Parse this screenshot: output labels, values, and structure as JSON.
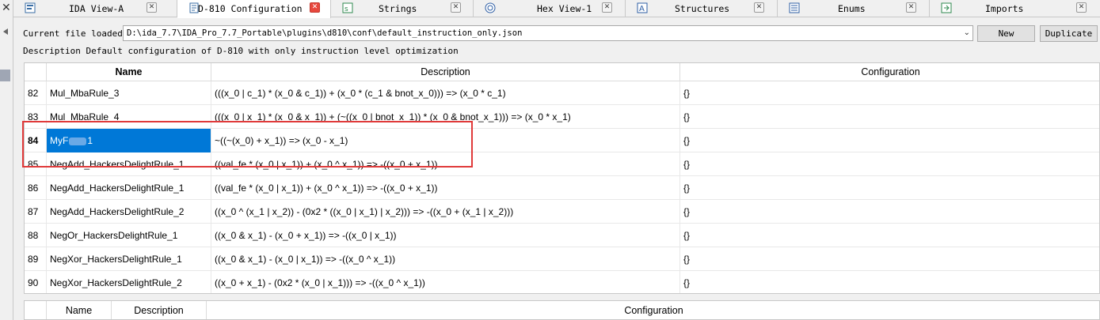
{
  "tabs": [
    {
      "label": "IDA View-A",
      "icon": "ida-view-icon",
      "active": false
    },
    {
      "label": "D-810 Configuration",
      "icon": "config-icon",
      "active": true
    },
    {
      "label": "Strings",
      "icon": "strings-icon",
      "active": false
    },
    {
      "label": "Hex View-1",
      "icon": "hex-view-icon",
      "active": false
    },
    {
      "label": "Structures",
      "icon": "structures-icon",
      "active": false
    },
    {
      "label": "Enums",
      "icon": "enums-icon",
      "active": false
    },
    {
      "label": "Imports",
      "icon": "imports-icon",
      "active": false
    }
  ],
  "file": {
    "label": "Current file loaded:",
    "path": "D:\\ida_7.7\\IDA_Pro_7.7_Portable\\plugins\\d810\\conf\\default_instruction_only.json"
  },
  "buttons": {
    "new": "New",
    "duplicate": "Duplicate"
  },
  "description": {
    "label": "Description",
    "value": "Default configuration of D-810 with only instruction level optimization"
  },
  "table": {
    "headers": {
      "name": "Name",
      "description": "Description",
      "configuration": "Configuration"
    },
    "rows": [
      {
        "num": "82",
        "name": "Mul_MbaRule_3",
        "desc": "(((x_0 | c_1) * (x_0 & c_1)) + (x_0 * (c_1 & bnot_x_0))) => (x_0 * c_1)",
        "conf": "{}"
      },
      {
        "num": "83",
        "name": "Mul_MbaRule_4",
        "desc": "(((x_0 | x_1) * (x_0 & x_1)) + (~((x_0 | bnot_x_1)) * (x_0 & bnot_x_1))) => (x_0 * x_1)",
        "conf": "{}"
      },
      {
        "num": "84",
        "name_prefix": "MyF",
        "name_suffix": "1",
        "desc": "~((~(x_0) + x_1)) => (x_0 - x_1)",
        "conf": "{}",
        "selected": true
      },
      {
        "num": "85",
        "name": "NegAdd_HackersDelightRule_1",
        "desc": "((val_fe * (x_0 | x_1)) + (x_0 ^ x_1)) => -((x_0 + x_1))",
        "conf": "{}"
      },
      {
        "num": "86",
        "name": "NegAdd_HackersDelightRule_1",
        "desc": "((val_fe * (x_0 | x_1)) + (x_0 ^ x_1)) => -((x_0 + x_1))",
        "conf": "{}"
      },
      {
        "num": "87",
        "name": "NegAdd_HackersDelightRule_2",
        "desc": "((x_0 ^ (x_1 | x_2)) - (0x2 * ((x_0 | x_1) | x_2))) => -((x_0 + (x_1 | x_2)))",
        "conf": "{}"
      },
      {
        "num": "88",
        "name": "NegOr_HackersDelightRule_1",
        "desc": "((x_0 & x_1) - (x_0 + x_1)) => -((x_0 | x_1))",
        "conf": "{}"
      },
      {
        "num": "89",
        "name": "NegXor_HackersDelightRule_1",
        "desc": "((x_0 & x_1) - (x_0 | x_1)) => -((x_0 ^ x_1))",
        "conf": "{}"
      },
      {
        "num": "90",
        "name": "NegXor_HackersDelightRule_2",
        "desc": "((x_0 + x_1) - (0x2 * (x_0 | x_1))) => -((x_0 ^ x_1))",
        "conf": "{}"
      }
    ]
  },
  "bottom_table": {
    "headers": {
      "name": "Name",
      "description": "Description",
      "configuration": "Configuration"
    }
  },
  "colors": {
    "selection": "#0078d7",
    "highlight_box": "#e03a3a",
    "active_close": "#e8483e"
  }
}
